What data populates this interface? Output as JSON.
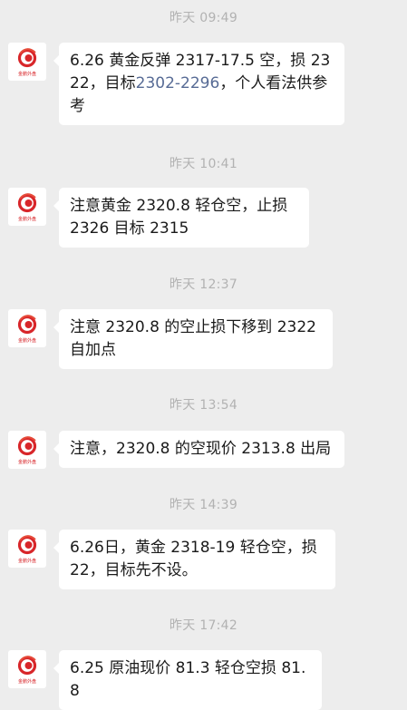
{
  "avatar": {
    "icon": "red-swirl-logo",
    "caption": "金鹏外盘"
  },
  "messages": [
    {
      "time": "昨天 09:49",
      "text_before": "6.26 黄金反弹 2317-17.5 空，损 2322，目标",
      "link": "2302-2296",
      "text_after": "，个人看法供参考"
    },
    {
      "time": "昨天 10:41",
      "text": "注意黄金 2320.8 轻仓空，止损 2326 目标 2315"
    },
    {
      "time": "昨天 12:37",
      "text": "注意 2320.8 的空止损下移到 2322 自加点"
    },
    {
      "time": "昨天 13:54",
      "text": "注意，2320.8 的空现价 2313.8 出局"
    },
    {
      "time": "昨天 14:39",
      "text": "6.26日，黄金 2318-19 轻仓空，损 22，目标先不设。"
    },
    {
      "time": "昨天 17:42",
      "text": "6.25 原油现价 81.3 轻仓空损 81.8"
    }
  ],
  "colors": {
    "background": "#ededed",
    "bubble": "#ffffff",
    "timestamp": "#b2b2b2",
    "link": "#576b95",
    "logo_red": "#d8262a"
  }
}
